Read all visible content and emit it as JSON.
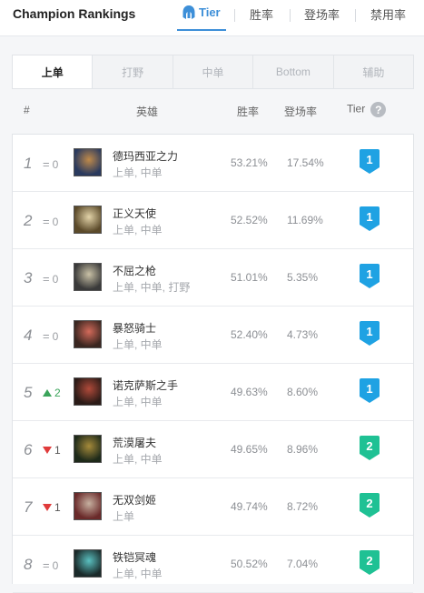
{
  "header": {
    "title": "Champion Rankings",
    "tabs": [
      {
        "label": "Tier",
        "active": true,
        "icon": "helmet-icon"
      },
      {
        "label": "胜率",
        "active": false
      },
      {
        "label": "登场率",
        "active": false
      },
      {
        "label": "禁用率",
        "active": false
      }
    ]
  },
  "positions": [
    {
      "label": "上单",
      "active": true
    },
    {
      "label": "打野",
      "active": false
    },
    {
      "label": "中单",
      "active": false
    },
    {
      "label": "Bottom",
      "active": false
    },
    {
      "label": "辅助",
      "active": false
    }
  ],
  "columns": {
    "rank": "#",
    "champion": "英雄",
    "win_rate": "胜率",
    "pick_rate": "登场率",
    "tier": "Tier",
    "help": "?"
  },
  "colors": {
    "accent": "#3d8fd8",
    "tier1": "#1fa2e3",
    "tier2": "#1fc194",
    "up": "#3aa45a",
    "down": "#e03b3b"
  },
  "rows": [
    {
      "rank": "1",
      "change_type": "same",
      "change": "0",
      "name": "德玛西亚之力",
      "roles": "上单, 中单",
      "win_rate": "53.21%",
      "pick_rate": "17.54%",
      "tier": "1",
      "avatar_colors": [
        "#2a3a5e",
        "#c08a4a"
      ]
    },
    {
      "rank": "2",
      "change_type": "same",
      "change": "0",
      "name": "正义天使",
      "roles": "上单, 中单",
      "win_rate": "52.52%",
      "pick_rate": "11.69%",
      "tier": "1",
      "avatar_colors": [
        "#5b4a2a",
        "#e2d3a8"
      ]
    },
    {
      "rank": "3",
      "change_type": "same",
      "change": "0",
      "name": "不屈之枪",
      "roles": "上单, 中单, 打野",
      "win_rate": "51.01%",
      "pick_rate": "5.35%",
      "tier": "1",
      "avatar_colors": [
        "#3a3a3a",
        "#c9c1a6"
      ]
    },
    {
      "rank": "4",
      "change_type": "same",
      "change": "0",
      "name": "暴怒骑士",
      "roles": "上单, 中单",
      "win_rate": "52.40%",
      "pick_rate": "4.73%",
      "tier": "1",
      "avatar_colors": [
        "#3a2620",
        "#d36a5a"
      ]
    },
    {
      "rank": "5",
      "change_type": "up",
      "change": "2",
      "name": "诺克萨斯之手",
      "roles": "上单, 中单",
      "win_rate": "49.63%",
      "pick_rate": "8.60%",
      "tier": "1",
      "avatar_colors": [
        "#2b1b17",
        "#b04a3a"
      ]
    },
    {
      "rank": "6",
      "change_type": "down",
      "change": "1",
      "name": "荒漠屠夫",
      "roles": "上单, 中单",
      "win_rate": "49.65%",
      "pick_rate": "8.96%",
      "tier": "2",
      "avatar_colors": [
        "#1e2a1a",
        "#a58a3a"
      ]
    },
    {
      "rank": "7",
      "change_type": "down",
      "change": "1",
      "name": "无双剑姬",
      "roles": "上单",
      "win_rate": "49.74%",
      "pick_rate": "8.72%",
      "tier": "2",
      "avatar_colors": [
        "#6a2a2a",
        "#c6b0a0"
      ]
    },
    {
      "rank": "8",
      "change_type": "same",
      "change": "0",
      "name": "铁铠冥魂",
      "roles": "上单, 中单",
      "win_rate": "50.52%",
      "pick_rate": "7.04%",
      "tier": "2",
      "avatar_colors": [
        "#1a2a2a",
        "#5ac0c0"
      ]
    }
  ]
}
